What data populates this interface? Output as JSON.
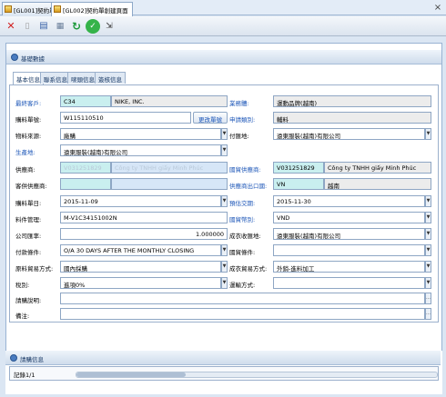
{
  "tabs": [
    {
      "label": "[GL001]契約單"
    },
    {
      "label": "[GL002]契約單創建頁面"
    }
  ],
  "toolbar": {
    "icons": [
      "close-icon",
      "delete-icon",
      "save-icon",
      "print-icon",
      "refresh-icon",
      "confirm-icon",
      "exit-icon"
    ]
  },
  "sections": {
    "basic": "基礎數據",
    "detail": "請購信息"
  },
  "inner_tabs": [
    "基本信息",
    "聯系信息",
    "嘜頭信息",
    "簽核信息"
  ],
  "form": {
    "customer_label": "最終客戶:",
    "customer_code": "C34",
    "customer_name": "NIKE, INC.",
    "business_label": "業務體:",
    "business_value": "運動品牌(越南)",
    "purchase_no_label": "購料單號:",
    "purchase_no_value": "W115110510",
    "change_no_button": "更改單號",
    "apply_type_label": "申請類別:",
    "apply_type_value": "輔料",
    "material_source_label": "物料來源:",
    "material_source_value": "廠購",
    "payment_label": "付匯地:",
    "payment_value": "遠東服裝(越南)有限公司",
    "producer_label": "生產地:",
    "producer_value": "遠東服裝(越南)有限公司",
    "supplier_label": "供應商:",
    "supplier_code": "V031251829",
    "supplier_name": "Công ty TNHH giấy Minh Phúc",
    "domestic_supplier_label": "國貿供應商:",
    "domestic_supplier_code": "V031251829",
    "domestic_supplier_name": "Công ty TNHH giấy Minh Phúc",
    "customer_supplier_label": "客供供應商:",
    "customer_supplier_value": "",
    "supplier_origin_label": "供應商出口國:",
    "supplier_origin_code": "VN",
    "supplier_origin_name": "越南",
    "purchase_date_label": "購料單日:",
    "purchase_date_value": "2015-11-09",
    "expected_delivery_label": "預估交期:",
    "expected_delivery_value": "2015-11-30",
    "contract_mgmt_label": "料件管理:",
    "contract_mgmt_value": "M-V1C34151002N",
    "domestic_currency_label": "國貿幣別:",
    "domestic_currency_value": "VND",
    "exchange_rate_label": "公司匯率:",
    "exchange_rate_value": "1.000000",
    "receive_label": "成衣收匯地:",
    "receive_value": "遠東服裝(越南)有限公司",
    "payment_terms_label": "付款條件:",
    "payment_terms_value": "O/A 30 DAYS AFTER THE MONTHLY CLOSING",
    "trade_terms_label": "國貿條件:",
    "trade_terms_value": "",
    "material_trade_label": "原料貿易方式:",
    "material_trade_value": "國內採購",
    "garment_trade_label": "成衣貿易方式:",
    "garment_trade_value": "外銷-進料加工",
    "tax_label": "稅別:",
    "tax_value": "進項0%",
    "transport_label": "運輸方式:",
    "transport_value": "",
    "purchase_desc_label": "請購說明:",
    "purchase_desc_value": "",
    "remark_label": "備注:",
    "remark_value": ""
  },
  "grid": {
    "record_label": "記錄1/1"
  }
}
